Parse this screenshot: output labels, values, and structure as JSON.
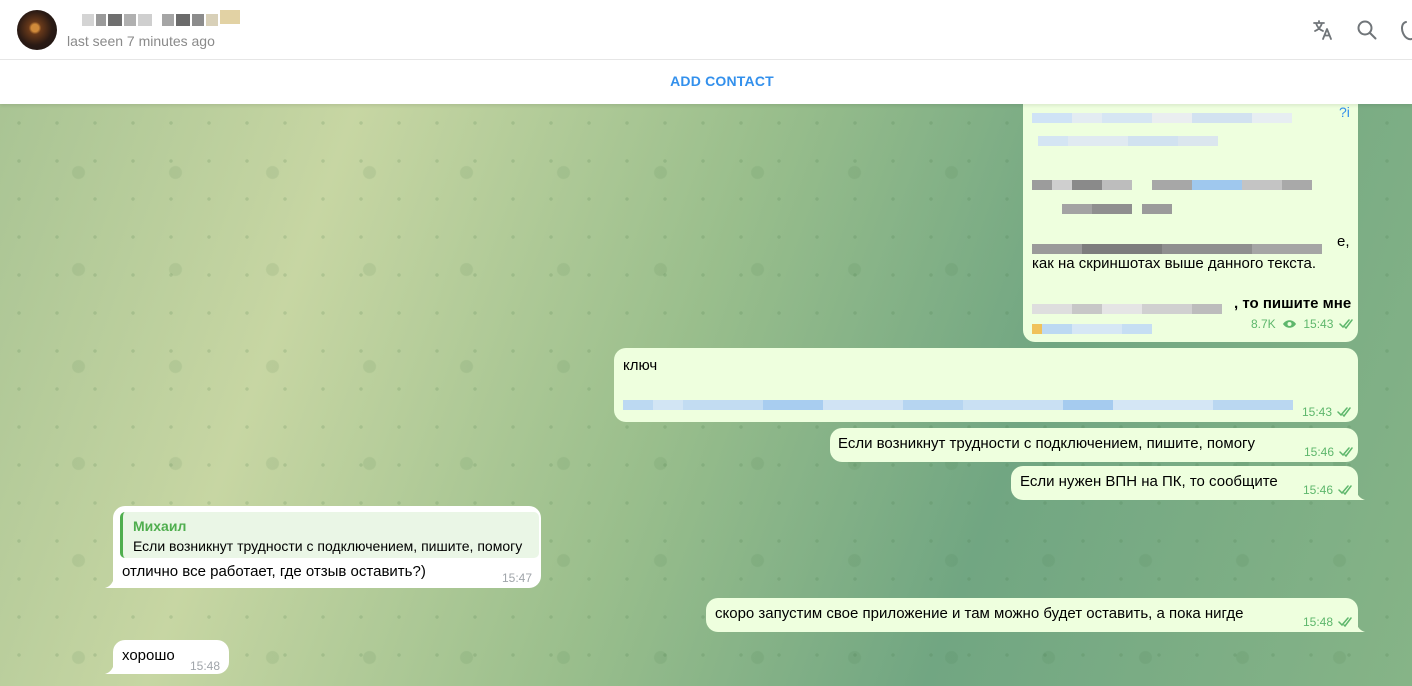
{
  "header": {
    "status": "last seen 7 minutes ago",
    "icons": [
      "translate-icon",
      "search-icon",
      "phone-icon"
    ]
  },
  "add_contact_label": "ADD CONTACT",
  "messages": {
    "m1": {
      "line": "как на скриншотах выше данного текста.",
      "bold_tail": ", то пишите мне",
      "partial_char": "е,",
      "partial_q": "?i",
      "views": "8.7K",
      "time": "15:43"
    },
    "m2": {
      "text": "ключ",
      "time": "15:43"
    },
    "m3": {
      "text": "Если возникнут трудности с подключением, пишите, помогу",
      "time": "15:46"
    },
    "m4": {
      "text": "Если нужен ВПН на ПК, то сообщите",
      "time": "15:46"
    },
    "m5": {
      "reply_name": "Михаил",
      "reply_text": "Если возникнут трудности с подключением, пишите, помогу",
      "text": "отлично все работает, где отзыв оставить?)",
      "time": "15:47"
    },
    "m6": {
      "text": "скоро запустим свое приложение и там можно будет оставить, а пока нигде",
      "time": "15:48"
    },
    "m7": {
      "text": "хорошо",
      "time": "15:48"
    }
  }
}
